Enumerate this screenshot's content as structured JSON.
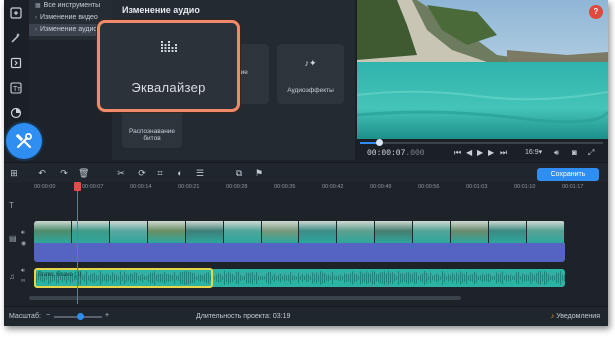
{
  "colors": {
    "accent": "#2f8ef2",
    "highlight_border": "#f08a6b",
    "help": "#e04a3c",
    "video_track": "#5563c2",
    "audio_track": "#2bb3a3",
    "playhead": "#e24b4b",
    "selection": "#e8d54a"
  },
  "sidebar": {
    "tools": [
      {
        "icon": "import-icon"
      },
      {
        "icon": "magic-wand-icon"
      },
      {
        "icon": "transitions-icon"
      },
      {
        "icon": "titles-icon"
      },
      {
        "icon": "filters-icon"
      },
      {
        "icon": "more-tools-icon"
      }
    ]
  },
  "tree": {
    "items": [
      {
        "label": "Все инструменты"
      },
      {
        "label": "Изменение видео"
      },
      {
        "label": "Изменение аудио"
      }
    ]
  },
  "panel": {
    "title": "Изменение аудио",
    "tiles": [
      {
        "label": "ние"
      },
      {
        "label": "Аудиоэффекты"
      },
      {
        "label": "Распознавание битов"
      }
    ]
  },
  "highlight": {
    "label": "Эквалайзер",
    "icon": "equalizer-icon"
  },
  "preview": {
    "help": "?",
    "timecode_main": "00:00:07",
    "timecode_ms": ".000",
    "aspect": "16:9",
    "position_fraction": 0.08
  },
  "toolbar": {
    "save_label": "Сохранить"
  },
  "ruler": {
    "ticks": [
      "00:00:00",
      "00:00:07",
      "00:00:14",
      "00:00:21",
      "00:00:28",
      "00:00:35",
      "00:00:42",
      "00:00:49",
      "00:00:56",
      "00:01:03",
      "00:01:10",
      "00:01:17"
    ]
  },
  "audio": {
    "clip_name": "Bravo, Bravo (1)"
  },
  "status": {
    "scale_label": "Масштаб:",
    "duration_label": "Длительность проекта: 03:19",
    "notifications_label": "Уведомления",
    "zoom_level": 0.55
  }
}
